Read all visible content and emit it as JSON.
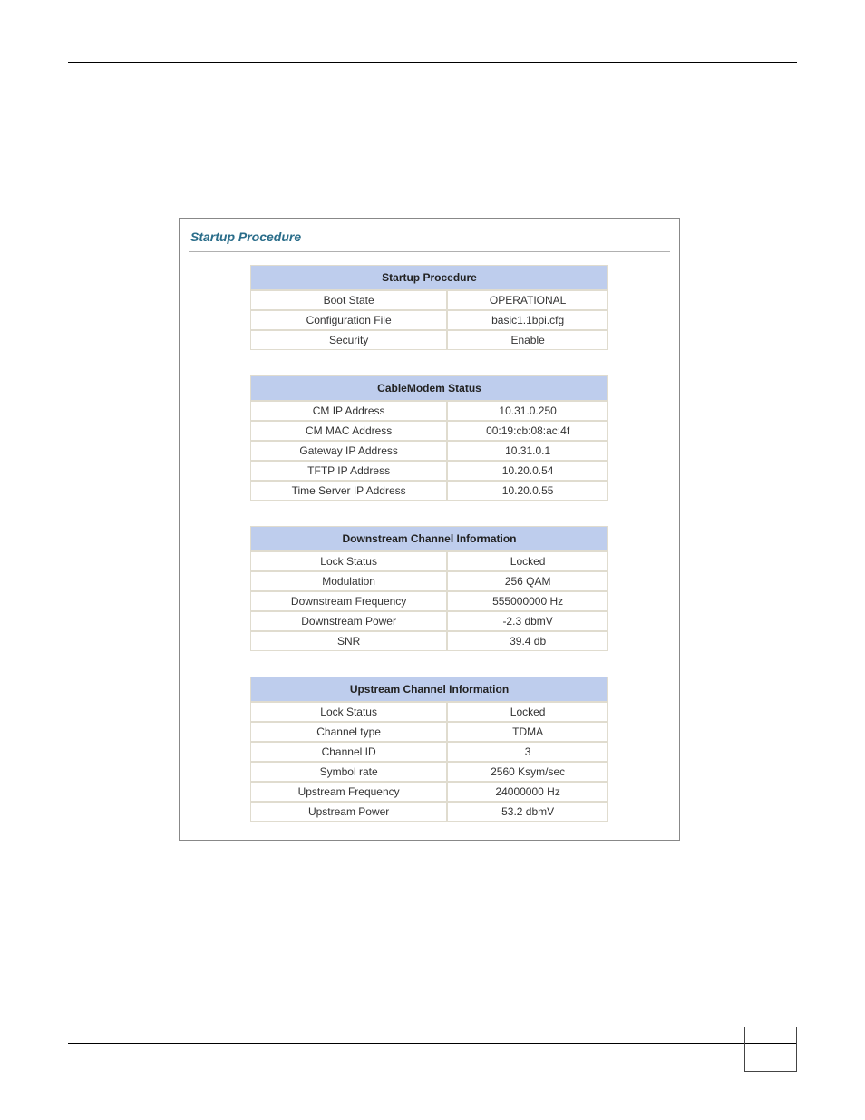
{
  "panel_title": "Startup Procedure",
  "sections": [
    {
      "header": "Startup Procedure",
      "rows": [
        {
          "k": "Boot State",
          "v": "OPERATIONAL"
        },
        {
          "k": "Configuration File",
          "v": "basic1.1bpi.cfg"
        },
        {
          "k": "Security",
          "v": "Enable"
        }
      ]
    },
    {
      "header": "CableModem Status",
      "rows": [
        {
          "k": "CM IP Address",
          "v": "10.31.0.250"
        },
        {
          "k": "CM MAC Address",
          "v": "00:19:cb:08:ac:4f"
        },
        {
          "k": "Gateway IP Address",
          "v": "10.31.0.1"
        },
        {
          "k": "TFTP IP Address",
          "v": "10.20.0.54"
        },
        {
          "k": "Time Server IP Address",
          "v": "10.20.0.55"
        }
      ]
    },
    {
      "header": "Downstream Channel Information",
      "rows": [
        {
          "k": "Lock Status",
          "v": "Locked"
        },
        {
          "k": "Modulation",
          "v": "256 QAM"
        },
        {
          "k": "Downstream Frequency",
          "v": "555000000 Hz"
        },
        {
          "k": "Downstream Power",
          "v": "-2.3 dbmV"
        },
        {
          "k": "SNR",
          "v": "39.4 db"
        }
      ]
    },
    {
      "header": "Upstream Channel Information",
      "rows": [
        {
          "k": "Lock Status",
          "v": "Locked"
        },
        {
          "k": "Channel type",
          "v": "TDMA"
        },
        {
          "k": "Channel ID",
          "v": "3"
        },
        {
          "k": "Symbol rate",
          "v": "2560 Ksym/sec"
        },
        {
          "k": "Upstream Frequency",
          "v": "24000000 Hz"
        },
        {
          "k": "Upstream Power",
          "v": "53.2 dbmV"
        }
      ]
    }
  ]
}
